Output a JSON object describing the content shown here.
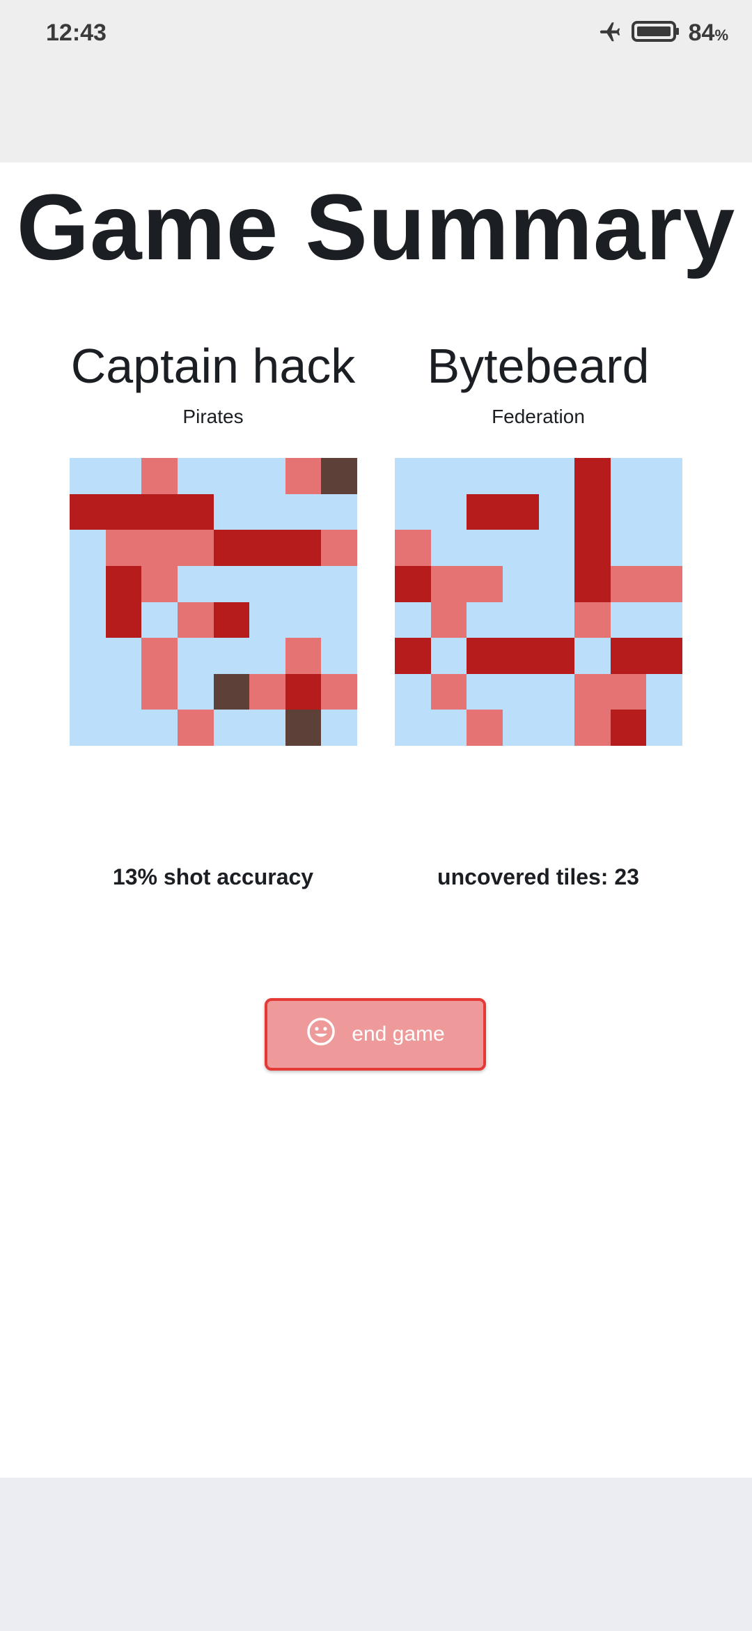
{
  "status_bar": {
    "time": "12:43",
    "battery_percent": "84",
    "battery_unit": "%",
    "icons": [
      "airplane-mode-icon",
      "battery-icon"
    ]
  },
  "title": "Game Summary",
  "players": [
    {
      "name": "Captain hack",
      "faction": "Pirates",
      "stat": "13% shot accuracy",
      "board": [
        [
          "w",
          "w",
          "m",
          "w",
          "w",
          "w",
          "m",
          "s"
        ],
        [
          "h",
          "h",
          "h",
          "h",
          "w",
          "w",
          "w",
          "w"
        ],
        [
          "w",
          "m",
          "m",
          "m",
          "h",
          "h",
          "h",
          "m"
        ],
        [
          "w",
          "h",
          "m",
          "w",
          "w",
          "w",
          "w",
          "w"
        ],
        [
          "w",
          "h",
          "w",
          "m",
          "h",
          "w",
          "w",
          "w"
        ],
        [
          "w",
          "w",
          "m",
          "w",
          "w",
          "w",
          "m",
          "w"
        ],
        [
          "w",
          "w",
          "m",
          "w",
          "s",
          "m",
          "h",
          "m"
        ],
        [
          "w",
          "w",
          "w",
          "m",
          "w",
          "w",
          "s",
          "w"
        ]
      ]
    },
    {
      "name": "Bytebeard",
      "faction": "Federation",
      "stat": "uncovered tiles: 23",
      "board": [
        [
          "w",
          "w",
          "w",
          "w",
          "w",
          "h",
          "w",
          "w"
        ],
        [
          "w",
          "w",
          "h",
          "h",
          "w",
          "h",
          "w",
          "w"
        ],
        [
          "m",
          "w",
          "w",
          "w",
          "w",
          "h",
          "w",
          "w"
        ],
        [
          "h",
          "m",
          "m",
          "w",
          "w",
          "h",
          "m",
          "m"
        ],
        [
          "w",
          "m",
          "w",
          "w",
          "w",
          "m",
          "w",
          "w"
        ],
        [
          "h",
          "w",
          "h",
          "h",
          "h",
          "w",
          "h",
          "h"
        ],
        [
          "w",
          "m",
          "w",
          "w",
          "w",
          "m",
          "m",
          "w"
        ],
        [
          "w",
          "w",
          "m",
          "w",
          "w",
          "m",
          "h",
          "w"
        ]
      ]
    }
  ],
  "board_legend": {
    "w": "#bbdefb",
    "m": "#e57373",
    "h": "#b71c1c",
    "s": "#5d4037"
  },
  "end_button": {
    "label": "end game",
    "icon": "smiley-face-icon",
    "background": "#ef9a9a",
    "border": "#e53935"
  }
}
